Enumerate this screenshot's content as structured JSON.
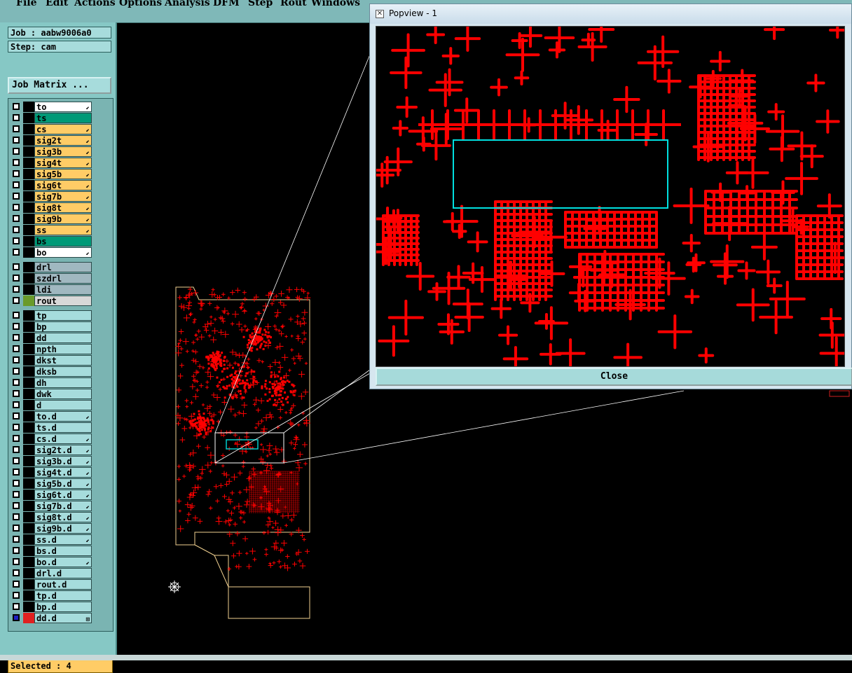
{
  "menu": [
    "File",
    "Edit",
    "Actions",
    "Options",
    "Analysis",
    "DFM",
    "Step",
    "Rout",
    "Windows"
  ],
  "job_label": "Job : aabw9006a0",
  "step_label": "Step: cam",
  "job_matrix_label": "Job Matrix ...",
  "layers": [
    {
      "name": "to",
      "color": "#ffffff",
      "flag": "⬋"
    },
    {
      "name": "ts",
      "color": "#009977",
      "flag": ""
    },
    {
      "name": "cs",
      "color": "#ffcc66",
      "flag": "⬋"
    },
    {
      "name": "sig2t",
      "color": "#ffcc66",
      "flag": "⬋"
    },
    {
      "name": "sig3b",
      "color": "#ffcc66",
      "flag": "⬋"
    },
    {
      "name": "sig4t",
      "color": "#ffcc66",
      "flag": "⬋"
    },
    {
      "name": "sig5b",
      "color": "#ffcc66",
      "flag": "⬋"
    },
    {
      "name": "sig6t",
      "color": "#ffcc66",
      "flag": "⬋"
    },
    {
      "name": "sig7b",
      "color": "#ffcc66",
      "flag": "⬋"
    },
    {
      "name": "sig8t",
      "color": "#ffcc66",
      "flag": "⬋"
    },
    {
      "name": "sig9b",
      "color": "#ffcc66",
      "flag": "⬋"
    },
    {
      "name": "ss",
      "color": "#ffcc66",
      "flag": "⬋"
    },
    {
      "name": "bs",
      "color": "#009977",
      "flag": ""
    },
    {
      "name": "bo",
      "color": "#ffffff",
      "flag": "⬋"
    },
    {
      "name": "drl",
      "color": "#a0b8c0",
      "flag": ""
    },
    {
      "name": "szdrl",
      "color": "#a0b8c0",
      "flag": ""
    },
    {
      "name": "ldi",
      "color": "#a0b8c0",
      "flag": ""
    },
    {
      "name": "rout",
      "color": "#d8d8d8",
      "flag": ""
    },
    {
      "name": "tp",
      "color": "#a6dcdc",
      "flag": ""
    },
    {
      "name": "bp",
      "color": "#a6dcdc",
      "flag": ""
    },
    {
      "name": "dd",
      "color": "#a6dcdc",
      "flag": ""
    },
    {
      "name": "npth",
      "color": "#a6dcdc",
      "flag": ""
    },
    {
      "name": "dkst",
      "color": "#a6dcdc",
      "flag": ""
    },
    {
      "name": "dksb",
      "color": "#a6dcdc",
      "flag": ""
    },
    {
      "name": "dh",
      "color": "#a6dcdc",
      "flag": ""
    },
    {
      "name": "dwk",
      "color": "#a6dcdc",
      "flag": ""
    },
    {
      "name": "d",
      "color": "#a6dcdc",
      "flag": ""
    },
    {
      "name": "to.d",
      "color": "#a6dcdc",
      "flag": "⬋"
    },
    {
      "name": "ts.d",
      "color": "#a6dcdc",
      "flag": ""
    },
    {
      "name": "cs.d",
      "color": "#a6dcdc",
      "flag": "⬋"
    },
    {
      "name": "sig2t.d",
      "color": "#a6dcdc",
      "flag": "⬋"
    },
    {
      "name": "sig3b.d",
      "color": "#a6dcdc",
      "flag": "⬋"
    },
    {
      "name": "sig4t.d",
      "color": "#a6dcdc",
      "flag": "⬋"
    },
    {
      "name": "sig5b.d",
      "color": "#a6dcdc",
      "flag": "⬋"
    },
    {
      "name": "sig6t.d",
      "color": "#a6dcdc",
      "flag": "⬋"
    },
    {
      "name": "sig7b.d",
      "color": "#a6dcdc",
      "flag": "⬋"
    },
    {
      "name": "sig8t.d",
      "color": "#a6dcdc",
      "flag": "⬋"
    },
    {
      "name": "sig9b.d",
      "color": "#a6dcdc",
      "flag": "⬋"
    },
    {
      "name": "ss.d",
      "color": "#a6dcdc",
      "flag": "⬋"
    },
    {
      "name": "bs.d",
      "color": "#a6dcdc",
      "flag": ""
    },
    {
      "name": "bo.d",
      "color": "#a6dcdc",
      "flag": "⬋"
    },
    {
      "name": "drl.d",
      "color": "#a6dcdc",
      "flag": ""
    },
    {
      "name": "rout.d",
      "color": "#a6dcdc",
      "flag": ""
    },
    {
      "name": "tp.d",
      "color": "#a6dcdc",
      "flag": ""
    },
    {
      "name": "bp.d",
      "color": "#a6dcdc",
      "flag": ""
    },
    {
      "name": "dd.d",
      "color": "#a6dcdc",
      "flag": "⊞"
    }
  ],
  "status_label": "Selected : 4",
  "popview": {
    "title": "Popview - 1",
    "close_label": "Close"
  },
  "colors": {
    "copper": "#ff0000",
    "highlight": "#00cccc",
    "board_outline": "#f0d090"
  }
}
